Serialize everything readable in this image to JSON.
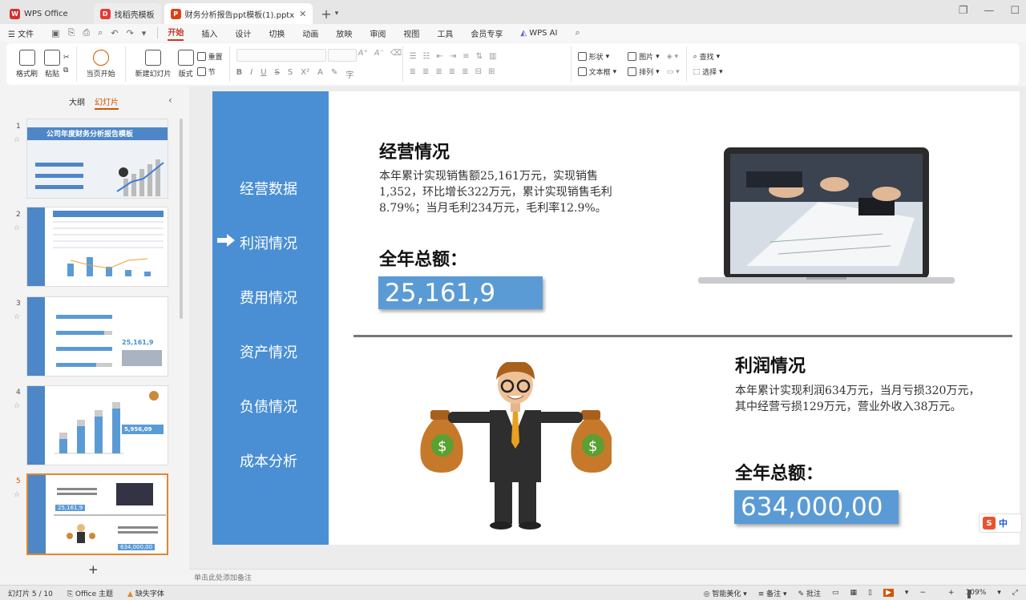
{
  "tabs": [
    {
      "label": "WPS Office",
      "icon": "wps-logo-icon",
      "color": "#d32f2f"
    },
    {
      "label": "找稻壳模板",
      "icon": "docer-icon",
      "color": "#e53935"
    },
    {
      "label": "财务分析报告ppt模板(1).pptx",
      "icon": "ppt-icon",
      "color": "#d84315",
      "active": true
    }
  ],
  "menu": {
    "file": "文件",
    "items": [
      "开始",
      "插入",
      "设计",
      "切换",
      "动画",
      "放映",
      "审阅",
      "视图",
      "工具",
      "会员专享"
    ],
    "active": "开始",
    "ai": "WPS AI"
  },
  "ribbon": {
    "format_painter": "格式刷",
    "paste": "粘贴",
    "from_current": "当页开始",
    "new_slide": "新建幻灯片",
    "layout": "版式",
    "reset": "重置",
    "section": "节",
    "shape": "形状",
    "picture": "图片",
    "textbox": "文本框",
    "arrange": "排列",
    "find": "查找",
    "select": "选择"
  },
  "panel": {
    "tab_outline": "大纲",
    "tab_slides": "幻灯片",
    "thumb1_title": "公司年度财务分析报告模板",
    "thumb3_total": "25,161,9",
    "thumb4_total": "5,956,09",
    "thumb5_total1": "25,161,9",
    "thumb5_total2": "634,000,00",
    "numbers": [
      "1",
      "2",
      "3",
      "4",
      "5"
    ]
  },
  "slide": {
    "nav": [
      "经营数据",
      "利润情况",
      "费用情况",
      "资产情况",
      "负债情况",
      "成本分析"
    ],
    "section1": {
      "title": "经营情况",
      "text": "本年累计实现销售额25,161万元，实现销售1,352，环比增长322万元，累计实现销售毛利8.79%；当月毛利234万元，毛利率12.9%。",
      "total_label": "全年总额：",
      "total_value": "25,161,9"
    },
    "section2": {
      "title": "利润情况",
      "text": "本年累计实现利润634万元，当月亏损320万元，其中经营亏损129万元，营业外收入38万元。",
      "total_label": "全年总额：",
      "total_value": "634,000,00"
    }
  },
  "notes_placeholder": "单击此处添加备注",
  "status": {
    "slide_counter": "幻灯片 5 / 10",
    "theme": "Office 主题",
    "missing_font": "缺失字体",
    "beautify": "智能美化",
    "notes": "备注",
    "comments": "批注",
    "zoom": "109%"
  },
  "ime": "中"
}
